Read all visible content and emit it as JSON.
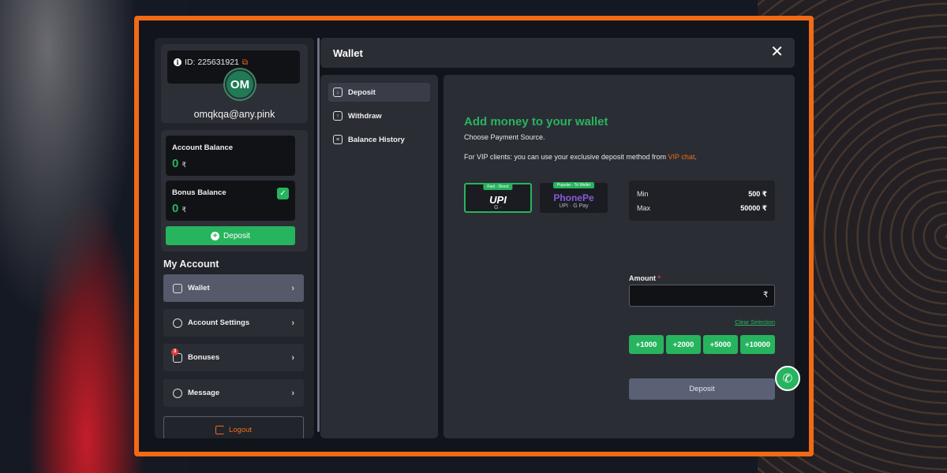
{
  "profile": {
    "id_label": "ID: 225631921",
    "avatar_initials": "OM",
    "email": "omqkqa@any.pink"
  },
  "balances": {
    "account_label": "Account Balance",
    "account_value": "0",
    "bonus_label": "Bonus Balance",
    "bonus_value": "0",
    "currency": "₹",
    "deposit_label": "Deposit"
  },
  "menu": {
    "heading": "My Account",
    "items": [
      {
        "label": "Wallet",
        "icon": "wallet-icon",
        "active": true
      },
      {
        "label": "Account Settings",
        "icon": "user-icon"
      },
      {
        "label": "Bonuses",
        "icon": "gift-icon",
        "badge": "3"
      },
      {
        "label": "Message",
        "icon": "message-icon"
      }
    ],
    "logout_label": "Logout"
  },
  "wallet": {
    "title": "Wallet",
    "tabs": [
      {
        "label": "Deposit",
        "icon": "download-icon",
        "active": true
      },
      {
        "label": "Withdraw",
        "icon": "upload-icon"
      },
      {
        "label": "Balance History",
        "icon": "history-icon"
      }
    ]
  },
  "deposit": {
    "heading": "Add money to your wallet",
    "choose_source": "Choose Payment Source.",
    "vip_text": "For VIP clients: you can use your exclusive deposit method from ",
    "vip_link": "VIP chat",
    "vip_end": ".",
    "methods": [
      {
        "tag": "Fast · Direct",
        "logo": "UPI",
        "sub": "G ·",
        "selected": true
      },
      {
        "tag": "Popular · To Wallet",
        "logo": "PhonePe",
        "sub": "UPI · G Pay"
      }
    ],
    "min_label": "Min",
    "min_value": "500 ₹",
    "max_label": "Max",
    "max_value": "50000 ₹",
    "amount_label": "Amount",
    "amount_required": "*",
    "amount_value": "",
    "amount_suffix": "₹",
    "clear_selection": "Clear Selection",
    "quick_amounts": [
      "+1000",
      "+2000",
      "+5000",
      "+10000"
    ],
    "submit_label": "Deposit"
  },
  "colors": {
    "accent_orange": "#f16a15",
    "accent_green": "#27b45e",
    "panel": "#2b2d35"
  }
}
